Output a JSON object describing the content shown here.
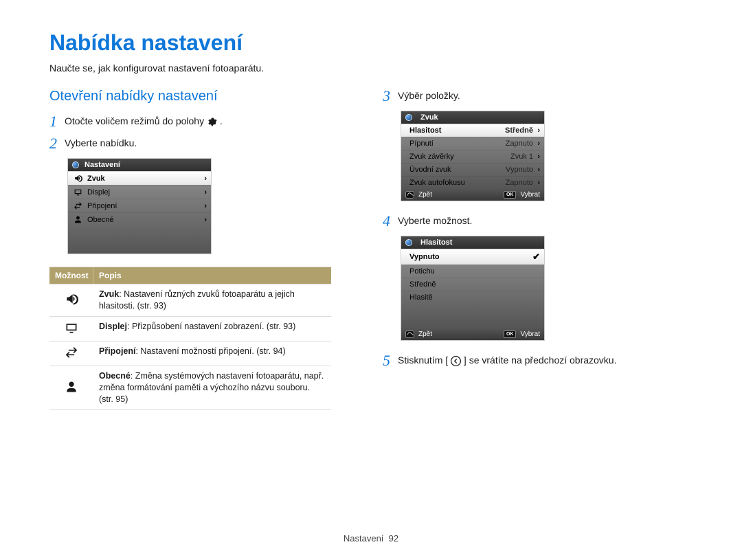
{
  "page_title": "Nabídka nastavení",
  "intro": "Naučte se, jak konfigurovat nastavení fotoaparátu.",
  "subheading": "Otevření nabídky nastavení",
  "steps": {
    "s1": {
      "num": "1",
      "text_before": "Otočte voličem režimů do polohy ",
      "text_after": "."
    },
    "s2": {
      "num": "2",
      "text": "Vyberte nabídku."
    },
    "s3": {
      "num": "3",
      "text": "Výběr položky."
    },
    "s4": {
      "num": "4",
      "text": "Vyberte možnost."
    },
    "s5": {
      "num": "5",
      "text_before": "Stisknutím [",
      "text_after": "] se vrátíte na předchozí obrazovku."
    }
  },
  "screen1": {
    "header": "Nastavení",
    "rows": [
      {
        "icon": "speaker",
        "label": "Zvuk",
        "selected": true
      },
      {
        "icon": "display",
        "label": "Displej"
      },
      {
        "icon": "swap",
        "label": "Připojení"
      },
      {
        "icon": "person",
        "label": "Obecné"
      }
    ]
  },
  "table": {
    "head1": "Možnost",
    "head2": "Popis",
    "rows": [
      {
        "icon": "speaker",
        "title": "Zvuk",
        "desc": ": Nastavení různých zvuků fotoaparátu a jejich hlasitosti. (str. 93)"
      },
      {
        "icon": "display",
        "title": "Displej",
        "desc": ": Přizpůsobení nastavení zobrazení. (str. 93)"
      },
      {
        "icon": "swap",
        "title": "Připojení",
        "desc": ": Nastavení možností připojení. (str. 94)"
      },
      {
        "icon": "person",
        "title": "Obecné",
        "desc": ": Změna systémových nastavení fotoaparátu, např. změna formátování paměti a výchozího názvu souboru. (str. 95)"
      }
    ]
  },
  "screen2": {
    "header": "Zvuk",
    "rows": [
      {
        "label": "Hlasitost",
        "value": "Středně",
        "selected": true
      },
      {
        "label": "Pípnutí",
        "value": "Zapnuto"
      },
      {
        "label": "Zvuk závěrky",
        "value": "Zvuk 1"
      },
      {
        "label": "Úvodní zvuk",
        "value": "Vypnuto"
      },
      {
        "label": "Zvuk autofokusu",
        "value": "Zapnuto"
      }
    ],
    "footer_back": "Zpět",
    "footer_select": "Vybrat"
  },
  "screen3": {
    "header": "Hlasitost",
    "rows": [
      {
        "label": "Vypnuto",
        "checked": true,
        "selected": true
      },
      {
        "label": "Potichu"
      },
      {
        "label": "Středně"
      },
      {
        "label": "Hlasitě"
      }
    ],
    "footer_back": "Zpět",
    "footer_select": "Vybrat"
  },
  "footer": {
    "label": "Nastavení",
    "page": "92"
  }
}
